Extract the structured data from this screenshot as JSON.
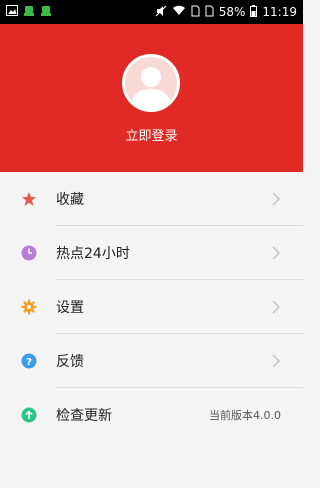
{
  "status_bar": {
    "battery": "58%",
    "time": "11:19"
  },
  "header": {
    "login_label": "立即登录"
  },
  "menu": {
    "items": [
      {
        "label": "收藏",
        "icon": "star-icon",
        "color": "#e85a4f"
      },
      {
        "label": "热点24小时",
        "icon": "clock-icon",
        "color": "#b57cd8"
      },
      {
        "label": "设置",
        "icon": "gear-icon",
        "color": "#f39c1d"
      },
      {
        "label": "反馈",
        "icon": "help-icon",
        "color": "#3a9fe8"
      },
      {
        "label": "检查更新",
        "icon": "upload-icon",
        "color": "#2cc489"
      }
    ],
    "version": "当前版本4.0.0"
  }
}
